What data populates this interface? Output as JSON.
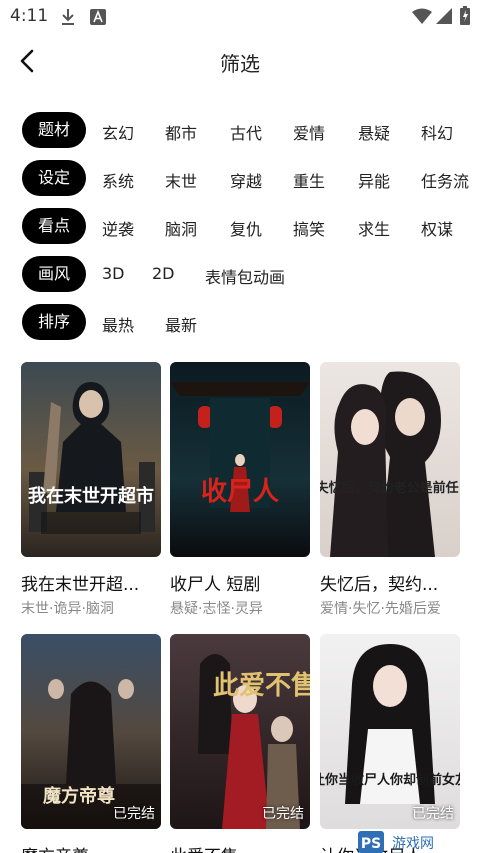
{
  "status": {
    "time": "4:11"
  },
  "header": {
    "title": "筛选"
  },
  "filters": [
    {
      "label": "题材",
      "options": [
        "玄幻",
        "都市",
        "古代",
        "爱情",
        "悬疑",
        "科幻"
      ]
    },
    {
      "label": "设定",
      "options": [
        "系统",
        "末世",
        "穿越",
        "重生",
        "异能",
        "任务流"
      ]
    },
    {
      "label": "看点",
      "options": [
        "逆袭",
        "脑洞",
        "复仇",
        "搞笑",
        "求生",
        "权谋"
      ]
    },
    {
      "label": "画风",
      "options": [
        "3D",
        "2D",
        "表情包动画"
      ]
    },
    {
      "label": "排序",
      "options": [
        "最热",
        "最新"
      ]
    }
  ],
  "books": [
    {
      "title": "我在末世开超...",
      "tags": "末世·诡异·脑洞",
      "cover_text": "我在末世开超市",
      "status": ""
    },
    {
      "title": "收尸人   短剧",
      "tags": "悬疑·志怪·灵异",
      "cover_text": "收尸人",
      "status": ""
    },
    {
      "title": "失忆后，契约...",
      "tags": "爱情·失忆·先婚后爱",
      "cover_text": "失忆后，契约老公是前任!",
      "status": ""
    },
    {
      "title": "魔方帝尊",
      "tags": "",
      "cover_text": "魔方帝尊",
      "status": "已完结"
    },
    {
      "title": "此爱不售",
      "tags": "",
      "cover_text": "此爱不售",
      "status": "已完结"
    },
    {
      "title": "让你当收尸人...",
      "tags": "",
      "cover_text": "让你当收尸人你却创前女友",
      "status": "已完结"
    }
  ],
  "watermark": {
    "text": "PS 游戏网"
  }
}
